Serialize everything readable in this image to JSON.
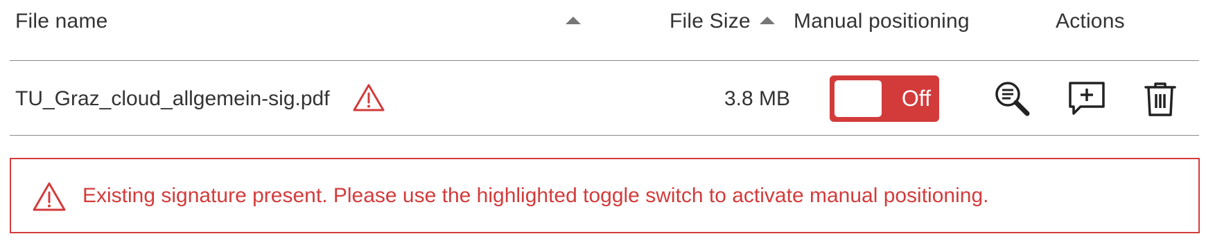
{
  "table": {
    "headers": {
      "file_name": "File name",
      "file_size": "File Size",
      "manual_positioning": "Manual positioning",
      "actions": "Actions"
    },
    "rows": [
      {
        "file_name": "TU_Graz_cloud_allgemein-sig.pdf",
        "file_size": "3.8 MB",
        "manual_positioning": {
          "state": "Off",
          "on": false
        },
        "has_warning": true
      }
    ],
    "action_icons": [
      "preview-icon",
      "comment-add-icon",
      "trash-icon"
    ]
  },
  "alert": {
    "text": "Existing signature present. Please use the highlighted toggle switch to activate manual positioning.",
    "icon": "warning-icon"
  },
  "colors": {
    "accent_red": "#d33b3b",
    "text": "#333333",
    "divider": "#8a8a8a"
  }
}
